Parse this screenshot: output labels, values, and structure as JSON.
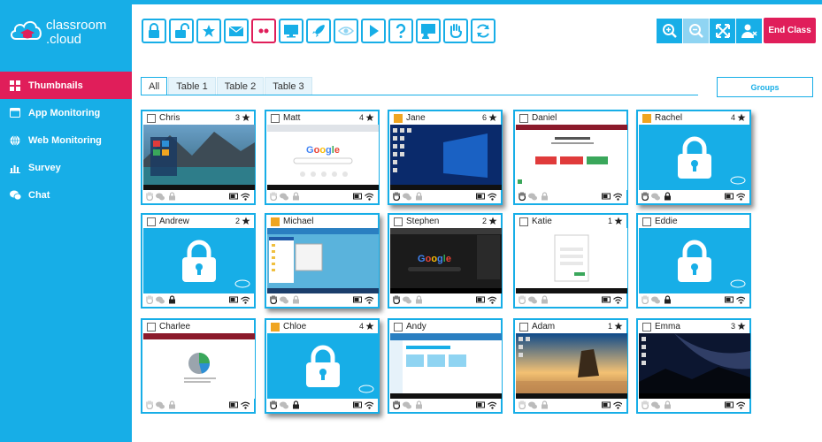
{
  "app": {
    "logo_line1": "classroom",
    "logo_line2": ".cloud"
  },
  "sidebar": {
    "items": [
      {
        "label": "Thumbnails",
        "icon": "grid-icon",
        "active": true
      },
      {
        "label": "App Monitoring",
        "icon": "window-icon",
        "active": false
      },
      {
        "label": "Web Monitoring",
        "icon": "globe-icon",
        "active": false
      },
      {
        "label": "Survey",
        "icon": "bar-chart-icon",
        "active": false
      },
      {
        "label": "Chat",
        "icon": "chat-icon",
        "active": false
      }
    ]
  },
  "toolbar": {
    "buttons": [
      "lock-icon",
      "unlock-icon",
      "star-icon",
      "mail-icon",
      "dots-icon",
      "monitor-icon",
      "rocket-icon",
      "eye-icon",
      "play-icon",
      "help-icon",
      "present-icon",
      "hand-icon",
      "refresh-icon"
    ],
    "right": [
      "zoom-in-icon",
      "zoom-out-icon",
      "fullscreen-icon",
      "user-remove-icon"
    ],
    "end_class": "End Class"
  },
  "tabs": [
    "All",
    "Table 1",
    "Table 2",
    "Table 3"
  ],
  "groups_label": "Groups",
  "colors": {
    "accent": "#17aee7",
    "brand": "#e01e5a",
    "check": "#f0a521"
  },
  "students": [
    {
      "name": "Chris",
      "stars": "3",
      "checked": false,
      "screen": "windows-lake"
    },
    {
      "name": "Matt",
      "stars": "4",
      "checked": false,
      "screen": "google-white"
    },
    {
      "name": "Jane",
      "stars": "6",
      "checked": true,
      "screen": "windows-blue"
    },
    {
      "name": "Daniel",
      "stars": "",
      "checked": false,
      "screen": "web-app"
    },
    {
      "name": "Rachel",
      "stars": "4",
      "checked": true,
      "screen": "locked"
    },
    {
      "name": "Andrew",
      "stars": "2",
      "checked": false,
      "screen": "locked"
    },
    {
      "name": "Michael",
      "stars": "",
      "checked": true,
      "screen": "explorer"
    },
    {
      "name": "Stephen",
      "stars": "2",
      "checked": false,
      "screen": "google-dark"
    },
    {
      "name": "Katie",
      "stars": "1",
      "checked": false,
      "screen": "login"
    },
    {
      "name": "Eddie",
      "stars": "",
      "checked": false,
      "screen": "locked"
    },
    {
      "name": "Charlee",
      "stars": "",
      "checked": false,
      "screen": "pie"
    },
    {
      "name": "Chloe",
      "stars": "4",
      "checked": true,
      "screen": "locked"
    },
    {
      "name": "Andy",
      "stars": "",
      "checked": false,
      "screen": "web-app2"
    },
    {
      "name": "Adam",
      "stars": "1",
      "checked": false,
      "screen": "beach"
    },
    {
      "name": "Emma",
      "stars": "3",
      "checked": false,
      "screen": "night"
    }
  ]
}
